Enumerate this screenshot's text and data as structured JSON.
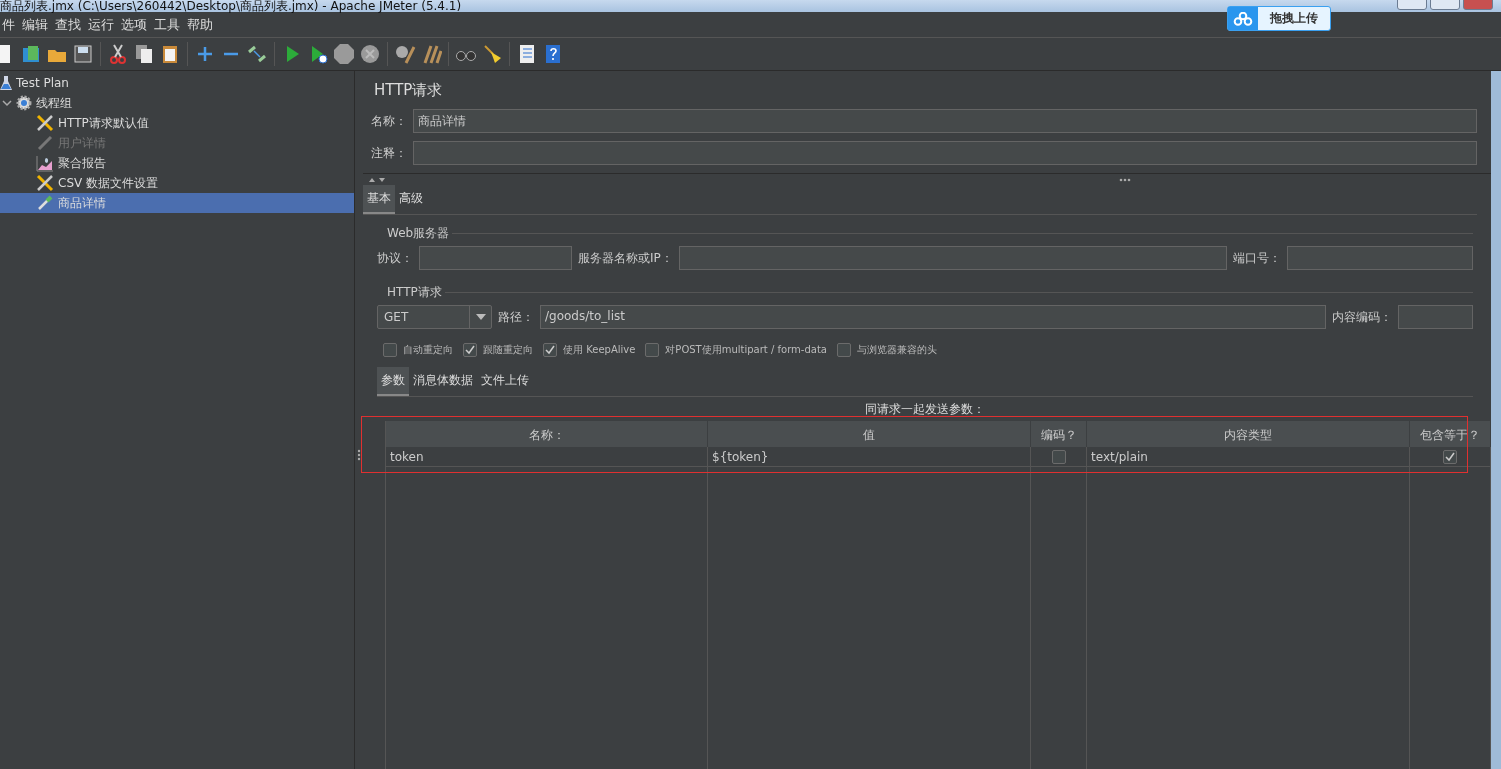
{
  "window": {
    "title": "商品列表.jmx (C:\\Users\\260442\\Desktop\\商品列表.jmx) - Apache JMeter (5.4.1)"
  },
  "upload_button": {
    "label": "拖拽上传"
  },
  "menu": [
    "件",
    "编辑",
    "查找",
    "运行",
    "选项",
    "工具",
    "帮助"
  ],
  "tree": [
    {
      "label": "Test Plan",
      "kind": "plan",
      "selected": false,
      "disabled": false,
      "children": [
        {
          "label": "线程组",
          "kind": "group",
          "expanded": true,
          "selected": false,
          "disabled": false,
          "children": [
            {
              "label": "HTTP请求默认值",
              "kind": "config",
              "selected": false,
              "disabled": false
            },
            {
              "label": "用户详情",
              "kind": "sampler",
              "selected": false,
              "disabled": true
            },
            {
              "label": "聚合报告",
              "kind": "report",
              "selected": false,
              "disabled": false
            },
            {
              "label": "CSV 数据文件设置",
              "kind": "config",
              "selected": false,
              "disabled": false
            },
            {
              "label": "商品详情",
              "kind": "sampler",
              "selected": true,
              "disabled": false
            }
          ]
        }
      ]
    }
  ],
  "panel": {
    "title": "HTTP请求",
    "name_field": {
      "label": "名称：",
      "value": "商品详情"
    },
    "comment_field": {
      "label": "注释："
    },
    "tabs": [
      {
        "label": "基本",
        "selected": true
      },
      {
        "label": "高级",
        "selected": false
      }
    ],
    "web_server": {
      "legend": "Web服务器",
      "protocol_label": "协议：",
      "server_label": "服务器名称或IP：",
      "port_label": "端口号："
    },
    "http_request": {
      "legend": "HTTP请求",
      "method": "GET",
      "path_label": "路径：",
      "path": "/goods/to_list",
      "encoding_label": "内容编码："
    },
    "options": [
      {
        "label": "自动重定向",
        "checked": false
      },
      {
        "label": "跟随重定向",
        "checked": true
      },
      {
        "label": "使用 KeepAlive",
        "checked": true
      },
      {
        "label": "对POST使用multipart / form-data",
        "checked": false
      },
      {
        "label": "与浏览器兼容的头",
        "checked": false
      }
    ],
    "sub_tabs": [
      {
        "label": "参数",
        "selected": true
      },
      {
        "label": "消息体数据",
        "selected": false
      },
      {
        "label": "文件上传",
        "selected": false
      }
    ],
    "params_caption": "同请求一起发送参数：",
    "table": {
      "columns": [
        "名称：",
        "值",
        "编码？",
        "内容类型",
        "包含等于？"
      ],
      "rows": [
        {
          "name": "token",
          "value": "${token}",
          "encode": false,
          "content_type": "text/plain",
          "include_equals": true
        }
      ]
    }
  }
}
